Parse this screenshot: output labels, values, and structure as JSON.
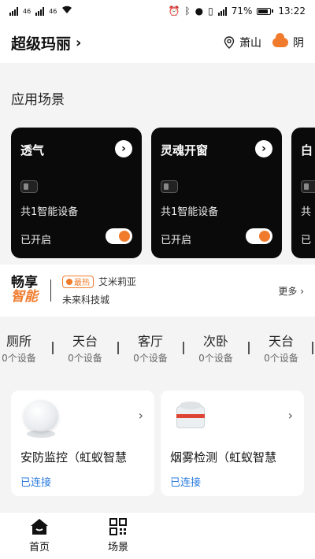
{
  "status_bar": {
    "left_signal_1": "46",
    "left_signal_2": "46",
    "battery": "71%",
    "time": "13:22",
    "icons": [
      "alarm-icon",
      "bluetooth-icon",
      "location-icon",
      "vibrate-icon",
      "signal-icon",
      "battery-icon"
    ]
  },
  "header": {
    "home_name": "超级玛丽",
    "chevron": "›",
    "location": "萧山",
    "weather": "阴",
    "weather_color": "#f07b2c"
  },
  "scenes_section": {
    "title": "应用场景",
    "cards": [
      {
        "title": "透气",
        "count": "共1智能设备",
        "status": "已开启",
        "enabled": true
      },
      {
        "title": "灵魂开窗",
        "count": "共1智能设备",
        "status": "已开启",
        "enabled": true
      },
      {
        "title": "白",
        "count": "共",
        "status": "已",
        "enabled": true
      }
    ]
  },
  "promo": {
    "logo_line1": "畅享",
    "logo_line2": "智能",
    "badge": "最热",
    "user": "艾米莉亚",
    "place": "未来科技城",
    "more": "更多"
  },
  "rooms": [
    {
      "name": "厕所",
      "count": "0个设备"
    },
    {
      "name": "天台",
      "count": "0个设备"
    },
    {
      "name": "客厅",
      "count": "0个设备"
    },
    {
      "name": "次卧",
      "count": "0个设备"
    },
    {
      "name": "天台",
      "count": "0个设备"
    }
  ],
  "devices": [
    {
      "name": "安防监控（虹蚁智慧",
      "status": "已连接",
      "icon": "motion-sensor-icon"
    },
    {
      "name": "烟雾检测（虹蚁智慧",
      "status": "已连接",
      "icon": "smoke-detector-icon"
    }
  ],
  "tabbar": {
    "home": "首页",
    "scenes": "场景"
  },
  "colors": {
    "accent": "#f07b2c",
    "connected": "#2a7be0",
    "card_dark": "#0a0a0a"
  }
}
